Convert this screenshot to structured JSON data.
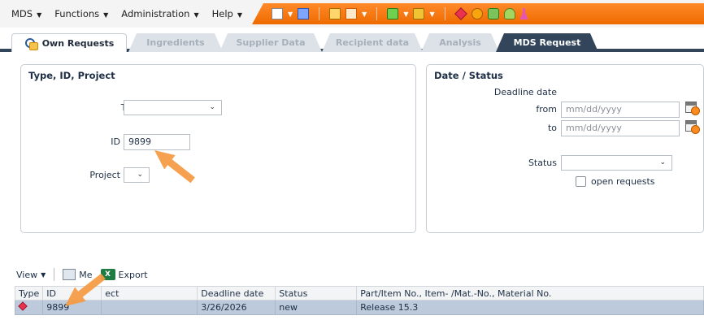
{
  "menubar": {
    "items": [
      {
        "label": "MDS"
      },
      {
        "label": "Functions"
      },
      {
        "label": "Administration"
      },
      {
        "label": "Help"
      }
    ]
  },
  "toolbar": {
    "icons": [
      "new-document-icon",
      "save-icon",
      "edit-icon",
      "pdf-icon",
      "upload-icon",
      "download-icon",
      "cube-icon",
      "ball-icon",
      "green-icon",
      "bag-icon",
      "flask-icon"
    ]
  },
  "tabs": [
    {
      "label": "Own Requests",
      "state": "active"
    },
    {
      "label": "Ingredients",
      "state": "disabled"
    },
    {
      "label": "Supplier Data",
      "state": "disabled"
    },
    {
      "label": "Recipient data",
      "state": "disabled"
    },
    {
      "label": "Analysis",
      "state": "disabled"
    },
    {
      "label": "MDS Request",
      "state": "highlight"
    }
  ],
  "left_panel": {
    "title": "Type, ID, Project",
    "type_label": "Type",
    "type_value": "",
    "id_label": "ID",
    "id_value": "9899",
    "project_label": "Project",
    "project_value": ""
  },
  "right_panel": {
    "title": "Date / Status",
    "deadline_label": "Deadline date",
    "from_label": "from",
    "from_placeholder": "mm/dd/yyyy",
    "to_label": "to",
    "to_placeholder": "mm/dd/yyyy",
    "status_label": "Status",
    "status_value": "",
    "open_requests_label": "open requests"
  },
  "listbar": {
    "view_label": "View",
    "menu_label": "Me",
    "export_label": "Export"
  },
  "table": {
    "columns": [
      "Type",
      "ID",
      "ect",
      "Deadline date",
      "Status",
      "Part/Item No., Item- /Mat.-No., Material No."
    ],
    "rows": [
      {
        "id": "9899",
        "project": "",
        "deadline": "3/26/2026",
        "status": "new",
        "part": "Release 15.3"
      }
    ]
  },
  "colors": {
    "toolbar_orange": "#f07a10",
    "tab_dark": "#32455a",
    "selected_row": "#bccadb",
    "arrow": "#f59a43"
  }
}
